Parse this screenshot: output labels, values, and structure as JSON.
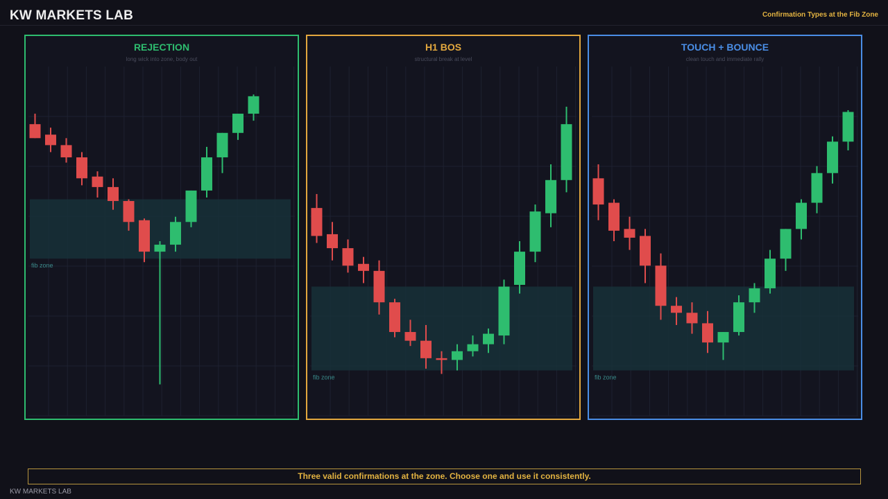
{
  "header": {
    "brand": "KW MARKETS LAB",
    "subtitle": "Confirmation Types at the Fib Zone"
  },
  "colors": {
    "bull": "#2ebd6f",
    "bear": "#e04c4c",
    "zone": "#173038",
    "zone_label": "#3a8a8a",
    "accent_gold": "#e3b341",
    "grid": "#1e2130"
  },
  "panels": [
    {
      "title": "REJECTION",
      "subtitle": "long wick into zone, body out",
      "border_color": "#2ebd6f",
      "zone_label": "fib zone"
    },
    {
      "title": "H1 BOS",
      "subtitle": "structural break at level",
      "border_color": "#e3a83e",
      "zone_label": "fib zone"
    },
    {
      "title": "TOUCH + BOUNCE",
      "subtitle": "clean touch and immediate rally",
      "border_color": "#4a8ee6",
      "zone_label": "fib zone"
    }
  ],
  "chart_data": [
    {
      "type": "candlestick",
      "title": "REJECTION",
      "subtitle": "long wick into zone, body out",
      "ylim": [
        0,
        100
      ],
      "grid": true,
      "zone": {
        "label": "fib zone",
        "low": 45,
        "high": 62
      },
      "candles": [
        {
          "o": 83.5,
          "h": 86.5,
          "l": 79.5,
          "c": 79.5
        },
        {
          "o": 80.5,
          "h": 82.5,
          "l": 75.5,
          "c": 77.5
        },
        {
          "o": 77.5,
          "h": 79.5,
          "l": 72.5,
          "c": 74
        },
        {
          "o": 74,
          "h": 75.5,
          "l": 66,
          "c": 68
        },
        {
          "o": 68.5,
          "h": 70,
          "l": 62.5,
          "c": 65.5
        },
        {
          "o": 65.5,
          "h": 68,
          "l": 59,
          "c": 61.5
        },
        {
          "o": 61.5,
          "h": 62,
          "l": 53,
          "c": 55.5
        },
        {
          "o": 56,
          "h": 56.5,
          "l": 44,
          "c": 47
        },
        {
          "o": 47,
          "h": 50,
          "l": 9,
          "c": 49
        },
        {
          "o": 49,
          "h": 57,
          "l": 47,
          "c": 55.5
        },
        {
          "o": 55.5,
          "h": 64.5,
          "l": 54,
          "c": 64.5
        },
        {
          "o": 64.5,
          "h": 77,
          "l": 62.5,
          "c": 74
        },
        {
          "o": 74,
          "h": 81,
          "l": 69.5,
          "c": 81
        },
        {
          "o": 81,
          "h": 86.5,
          "l": 79,
          "c": 86.5
        },
        {
          "o": 86.5,
          "h": 92,
          "l": 84.5,
          "c": 91.5
        }
      ]
    },
    {
      "type": "candlestick",
      "title": "H1 BOS",
      "subtitle": "structural break at level",
      "ylim": [
        0,
        100
      ],
      "grid": true,
      "zone": {
        "label": "fib zone",
        "low": 13,
        "high": 37
      },
      "candles": [
        {
          "o": 59.5,
          "h": 63.5,
          "l": 49.5,
          "c": 51.5
        },
        {
          "o": 52,
          "h": 55.5,
          "l": 44.5,
          "c": 48
        },
        {
          "o": 48,
          "h": 50.5,
          "l": 41,
          "c": 43
        },
        {
          "o": 43.5,
          "h": 45.5,
          "l": 38,
          "c": 41.5
        },
        {
          "o": 41.5,
          "h": 44.5,
          "l": 29,
          "c": 32.5
        },
        {
          "o": 32.5,
          "h": 33.5,
          "l": 22.5,
          "c": 24
        },
        {
          "o": 24,
          "h": 27.5,
          "l": 20,
          "c": 21.5
        },
        {
          "o": 21.5,
          "h": 26,
          "l": 13.5,
          "c": 16.5
        },
        {
          "o": 16.5,
          "h": 18.5,
          "l": 12,
          "c": 16
        },
        {
          "o": 16,
          "h": 20.5,
          "l": 13,
          "c": 18.5
        },
        {
          "o": 18.5,
          "h": 23,
          "l": 17,
          "c": 20.5
        },
        {
          "o": 20.5,
          "h": 25,
          "l": 18,
          "c": 23.5
        },
        {
          "o": 23,
          "h": 39,
          "l": 20.5,
          "c": 37
        },
        {
          "o": 37.5,
          "h": 50,
          "l": 35,
          "c": 47
        },
        {
          "o": 47,
          "h": 60.5,
          "l": 44,
          "c": 58.5
        },
        {
          "o": 58,
          "h": 72,
          "l": 54,
          "c": 67.5
        },
        {
          "o": 67.5,
          "h": 88.5,
          "l": 64,
          "c": 83.5
        }
      ]
    },
    {
      "type": "candlestick",
      "title": "TOUCH + BOUNCE",
      "subtitle": "clean touch and immediate rally",
      "ylim": [
        0,
        100
      ],
      "grid": true,
      "zone": {
        "label": "fib zone",
        "low": 13,
        "high": 37
      },
      "candles": [
        {
          "o": 68,
          "h": 72,
          "l": 56,
          "c": 60.5
        },
        {
          "o": 61,
          "h": 62,
          "l": 50,
          "c": 53
        },
        {
          "o": 53.5,
          "h": 57,
          "l": 47.5,
          "c": 51
        },
        {
          "o": 51.5,
          "h": 53.5,
          "l": 38,
          "c": 43
        },
        {
          "o": 43,
          "h": 46.5,
          "l": 27.5,
          "c": 31.5
        },
        {
          "o": 31.5,
          "h": 34,
          "l": 26,
          "c": 29.5
        },
        {
          "o": 29.5,
          "h": 32.5,
          "l": 23.5,
          "c": 26.5
        },
        {
          "o": 26.5,
          "h": 30,
          "l": 18,
          "c": 21
        },
        {
          "o": 21,
          "h": 24,
          "l": 16,
          "c": 24
        },
        {
          "o": 24,
          "h": 34.5,
          "l": 23,
          "c": 32.5
        },
        {
          "o": 32.5,
          "h": 38,
          "l": 29.5,
          "c": 36.5
        },
        {
          "o": 36.5,
          "h": 47.5,
          "l": 35,
          "c": 45
        },
        {
          "o": 45,
          "h": 53.5,
          "l": 41.5,
          "c": 53.5
        },
        {
          "o": 53.5,
          "h": 62,
          "l": 50.5,
          "c": 61
        },
        {
          "o": 61,
          "h": 71.5,
          "l": 58,
          "c": 69.5
        },
        {
          "o": 69.5,
          "h": 80,
          "l": 66.5,
          "c": 78.5
        },
        {
          "o": 78.5,
          "h": 87.5,
          "l": 76,
          "c": 87
        }
      ]
    }
  ],
  "footer": {
    "note": "Three valid confirmations at the zone. Choose one and use it consistently.",
    "brand": "KW MARKETS LAB"
  }
}
